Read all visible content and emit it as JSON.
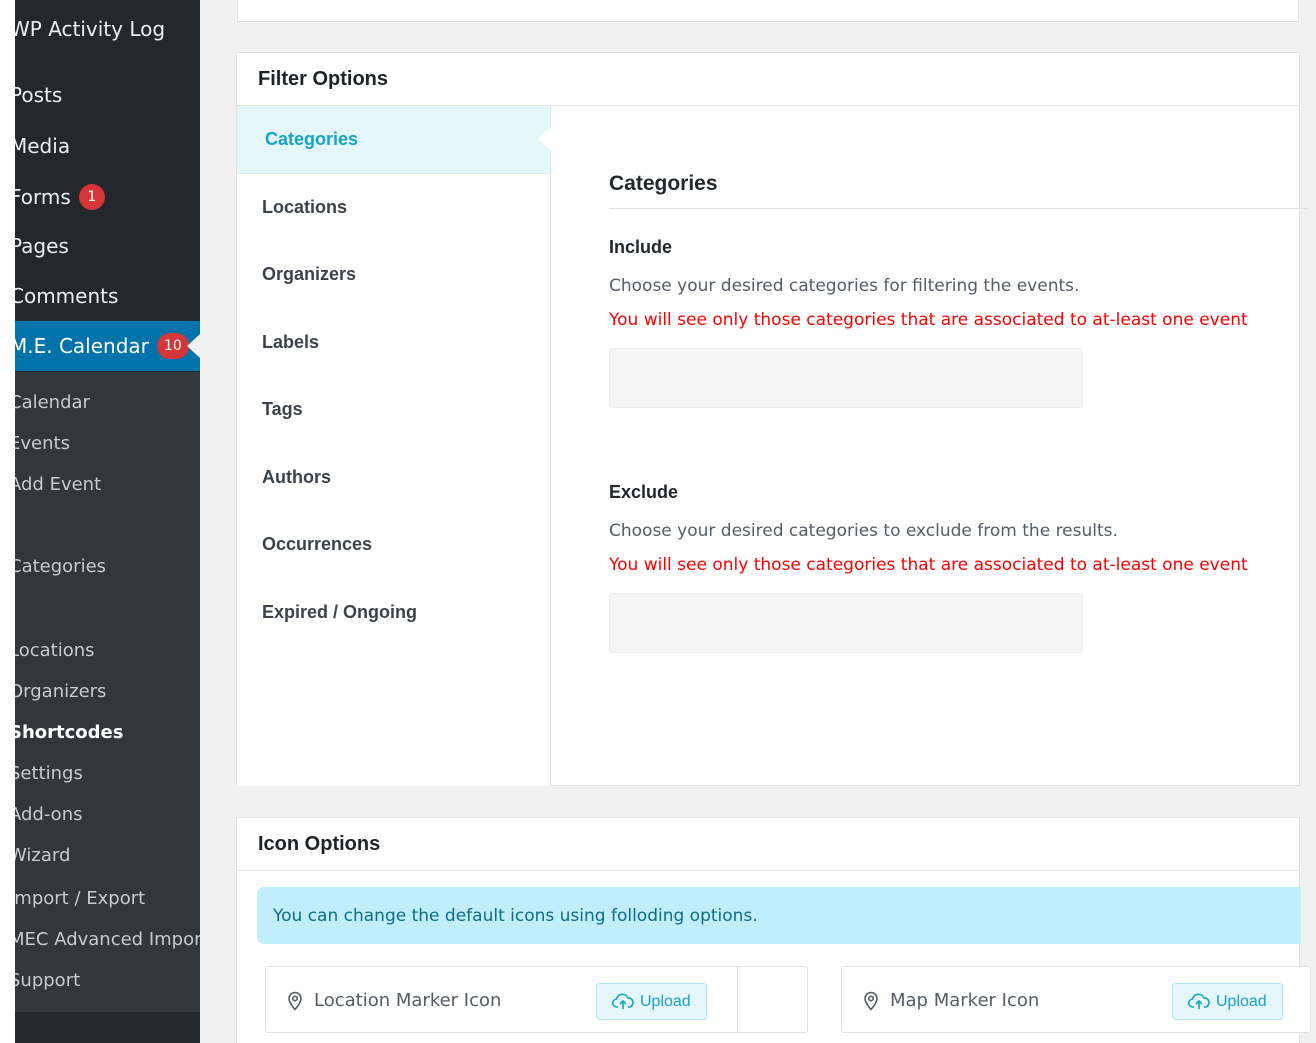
{
  "sidebar": {
    "top_items": [
      {
        "label": "WP Activity Log",
        "badge": ""
      },
      {
        "label": "Posts",
        "badge": ""
      },
      {
        "label": "Media",
        "badge": ""
      },
      {
        "label": "Forms",
        "badge": "1"
      },
      {
        "label": "Pages",
        "badge": ""
      },
      {
        "label": "Comments",
        "badge": ""
      },
      {
        "label": "M.E. Calendar",
        "badge": "10"
      }
    ],
    "sub_items": [
      "Calendar",
      "Events",
      "Add Event",
      "",
      "Categories",
      "",
      "Locations",
      "Organizers",
      "Shortcodes",
      "Settings",
      "Add-ons",
      "Wizard",
      "Import / Export",
      "MEC Advanced Import",
      "Support"
    ]
  },
  "filter": {
    "title": "Filter Options",
    "tabs": [
      "Categories",
      "Locations",
      "Organizers",
      "Labels",
      "Tags",
      "Authors",
      "Occurrences",
      "Expired / Ongoing"
    ],
    "pane_title": "Categories",
    "include": {
      "label": "Include",
      "description": "Choose your desired categories for filtering the events.",
      "warning": "You will see only those categories that are associated to at-least one event"
    },
    "exclude": {
      "label": "Exclude",
      "description": "Choose your desired categories to exclude from the results.",
      "warning": "You will see only those categories that are associated to at-least one event"
    }
  },
  "icons": {
    "title": "Icon Options",
    "info": "You can change the default icons using folloding options.",
    "items": [
      {
        "label": "Location Marker Icon",
        "button": "Upload"
      },
      {
        "label": "Map Marker Icon",
        "button": "Upload"
      }
    ]
  },
  "colors": {
    "accent": "#17a2c8",
    "sidebar": "#23282d",
    "active": "#0073aa",
    "badge": "#d63638",
    "warning": "#ff0000"
  }
}
